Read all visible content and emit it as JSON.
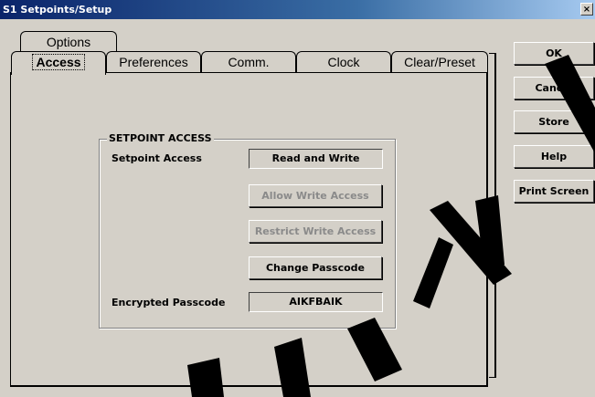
{
  "window": {
    "title": "S1 Setpoints/Setup",
    "close_glyph": "×"
  },
  "tabs": {
    "back": [
      {
        "label": "Options"
      }
    ],
    "front": [
      {
        "label": "Access",
        "active": true
      },
      {
        "label": "Preferences"
      },
      {
        "label": "Comm."
      },
      {
        "label": "Clock"
      },
      {
        "label": "Clear/Preset"
      }
    ]
  },
  "setpoint_access": {
    "group_title": "SETPOINT ACCESS",
    "setpoint_access_label": "Setpoint Access",
    "setpoint_access_value": "Read and Write",
    "allow_write_label": "Allow Write Access",
    "restrict_write_label": "Restrict Write Access",
    "change_passcode_label": "Change Passcode",
    "encrypted_passcode_label": "Encrypted Passcode",
    "encrypted_passcode_value": "AIKFBAIK"
  },
  "side_buttons": {
    "ok": "OK",
    "cancel": "Cancel",
    "store": "Store",
    "help": "Help",
    "print_screen": "Print Screen"
  },
  "colors": {
    "window_bg": "#d4d0c8",
    "title_bar": "#0a246a",
    "disabled_text": "#8a8a8a"
  }
}
